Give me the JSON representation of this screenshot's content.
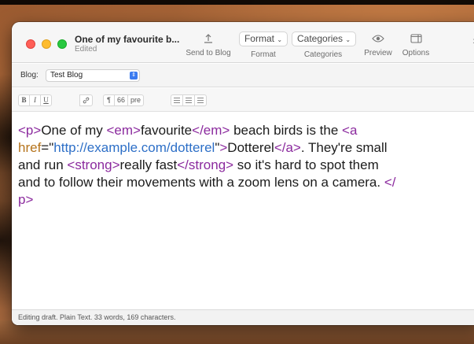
{
  "window": {
    "title": "One of my favourite b...",
    "subtitle": "Edited"
  },
  "toolbar": {
    "send_label": "Send to Blog",
    "format_value": "Format",
    "format_label": "Format",
    "categories_value": "Categories",
    "categories_label": "Categories",
    "preview_label": "Preview",
    "options_label": "Options",
    "more_icon": "chevron-double-right"
  },
  "blog": {
    "label": "Blog:",
    "selected": "Test Blog"
  },
  "format_buttons": {
    "bold": "B",
    "italic": "I",
    "underline": "U",
    "paragraph": "¶",
    "quote": "66",
    "pre": "pre"
  },
  "editor": {
    "tokens": {
      "p_open": "<p>",
      "t1": "One of my ",
      "em_open": "<em>",
      "t2": "favourite",
      "em_close": "</em>",
      "t3": " beach birds is the ",
      "a_open": "<a",
      "a_attr": "href",
      "eq": "=\"",
      "a_val": "http://example.com/dotterel",
      "q_close": "\"",
      "gt": ">",
      "t4": "Dotterel",
      "a_close": "</a>",
      "t5": ". They're small",
      "t6": "and run ",
      "strong_open": "<strong>",
      "t7": "really fast",
      "strong_close": "</strong>",
      "t8": " so it's hard to spot them",
      "t9": "and to follow their movements with a zoom lens on a camera. ",
      "p_close_a": "</",
      "p_close_b": "p>"
    }
  },
  "status": {
    "text": "Editing draft. Plain Text. 33 words, 169 characters."
  },
  "colors": {
    "tag": "#8b2a9e",
    "attribute": "#b5731b",
    "value": "#2d6fc7"
  }
}
